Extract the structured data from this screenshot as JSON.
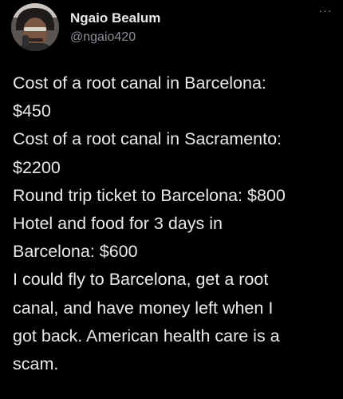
{
  "author": {
    "display_name": "Ngaio Bealum",
    "handle": "@ngaio420",
    "avatar_icon": "user-avatar"
  },
  "menu": {
    "more_icon": "more-options-icon",
    "more_glyph": "···"
  },
  "tweet": {
    "lines": [
      "Cost of a root canal in Barcelona:",
      "$450",
      "Cost of a root canal in Sacramento:",
      "$2200",
      "Round trip ticket to Barcelona: $800",
      "Hotel and food for 3 days in",
      "Barcelona: $600",
      "I could fly to Barcelona, get a root",
      "canal, and have money left when I",
      "got back. American health care is a",
      "scam."
    ]
  },
  "colors": {
    "background": "#000000",
    "text_primary": "#e7e9ea",
    "text_secondary": "#8b9097"
  }
}
